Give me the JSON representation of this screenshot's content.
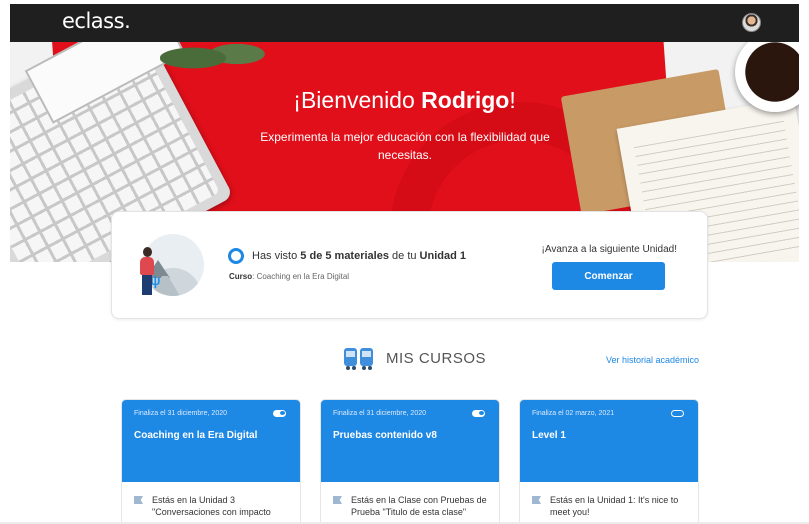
{
  "header": {
    "logo_text": "eclass",
    "logo_dot": ".",
    "avatar_icon": "user-avatar"
  },
  "hero": {
    "greeting": "¡Bienvenido ",
    "user_name": "Rodrigo",
    "greeting_end": "!",
    "subtitle": "Experimenta la mejor educación con la flexibilidad que necesitas."
  },
  "progress": {
    "text_prefix": "Has visto ",
    "materials": "5 de 5 materiales",
    "text_mid": " de tu ",
    "unit": "Unidad 1",
    "course_label": "Curso",
    "course_value": ": Coaching en la Era Digital",
    "next_label": "¡Avanza a la siguiente Unidad!",
    "start_button": "Comenzar"
  },
  "courses_section": {
    "title": "MIS CURSOS",
    "history_link": "Ver historial académico",
    "courses": [
      {
        "date": "Finaliza el 31 diciembre, 2020",
        "name": "Coaching en la Era Digital",
        "status": "Estás en la Unidad 3 \"Conversaciones con impacto",
        "toggle_on": true
      },
      {
        "date": "Finaliza el 31 diciembre, 2020",
        "name": "Pruebas contenido v8",
        "status": "Estás en la Clase con Pruebas de Prueba \"Titulo de esta clase\"",
        "toggle_on": true
      },
      {
        "date": "Finaliza el 02 marzo, 2021",
        "name": "Level 1",
        "status": "Estás en la Unidad 1: It's nice to meet you!",
        "toggle_on": false
      }
    ]
  },
  "colors": {
    "brand_blue": "#1e88e5",
    "hero_red": "#e10f1a",
    "topbar": "#1f1f1f"
  }
}
